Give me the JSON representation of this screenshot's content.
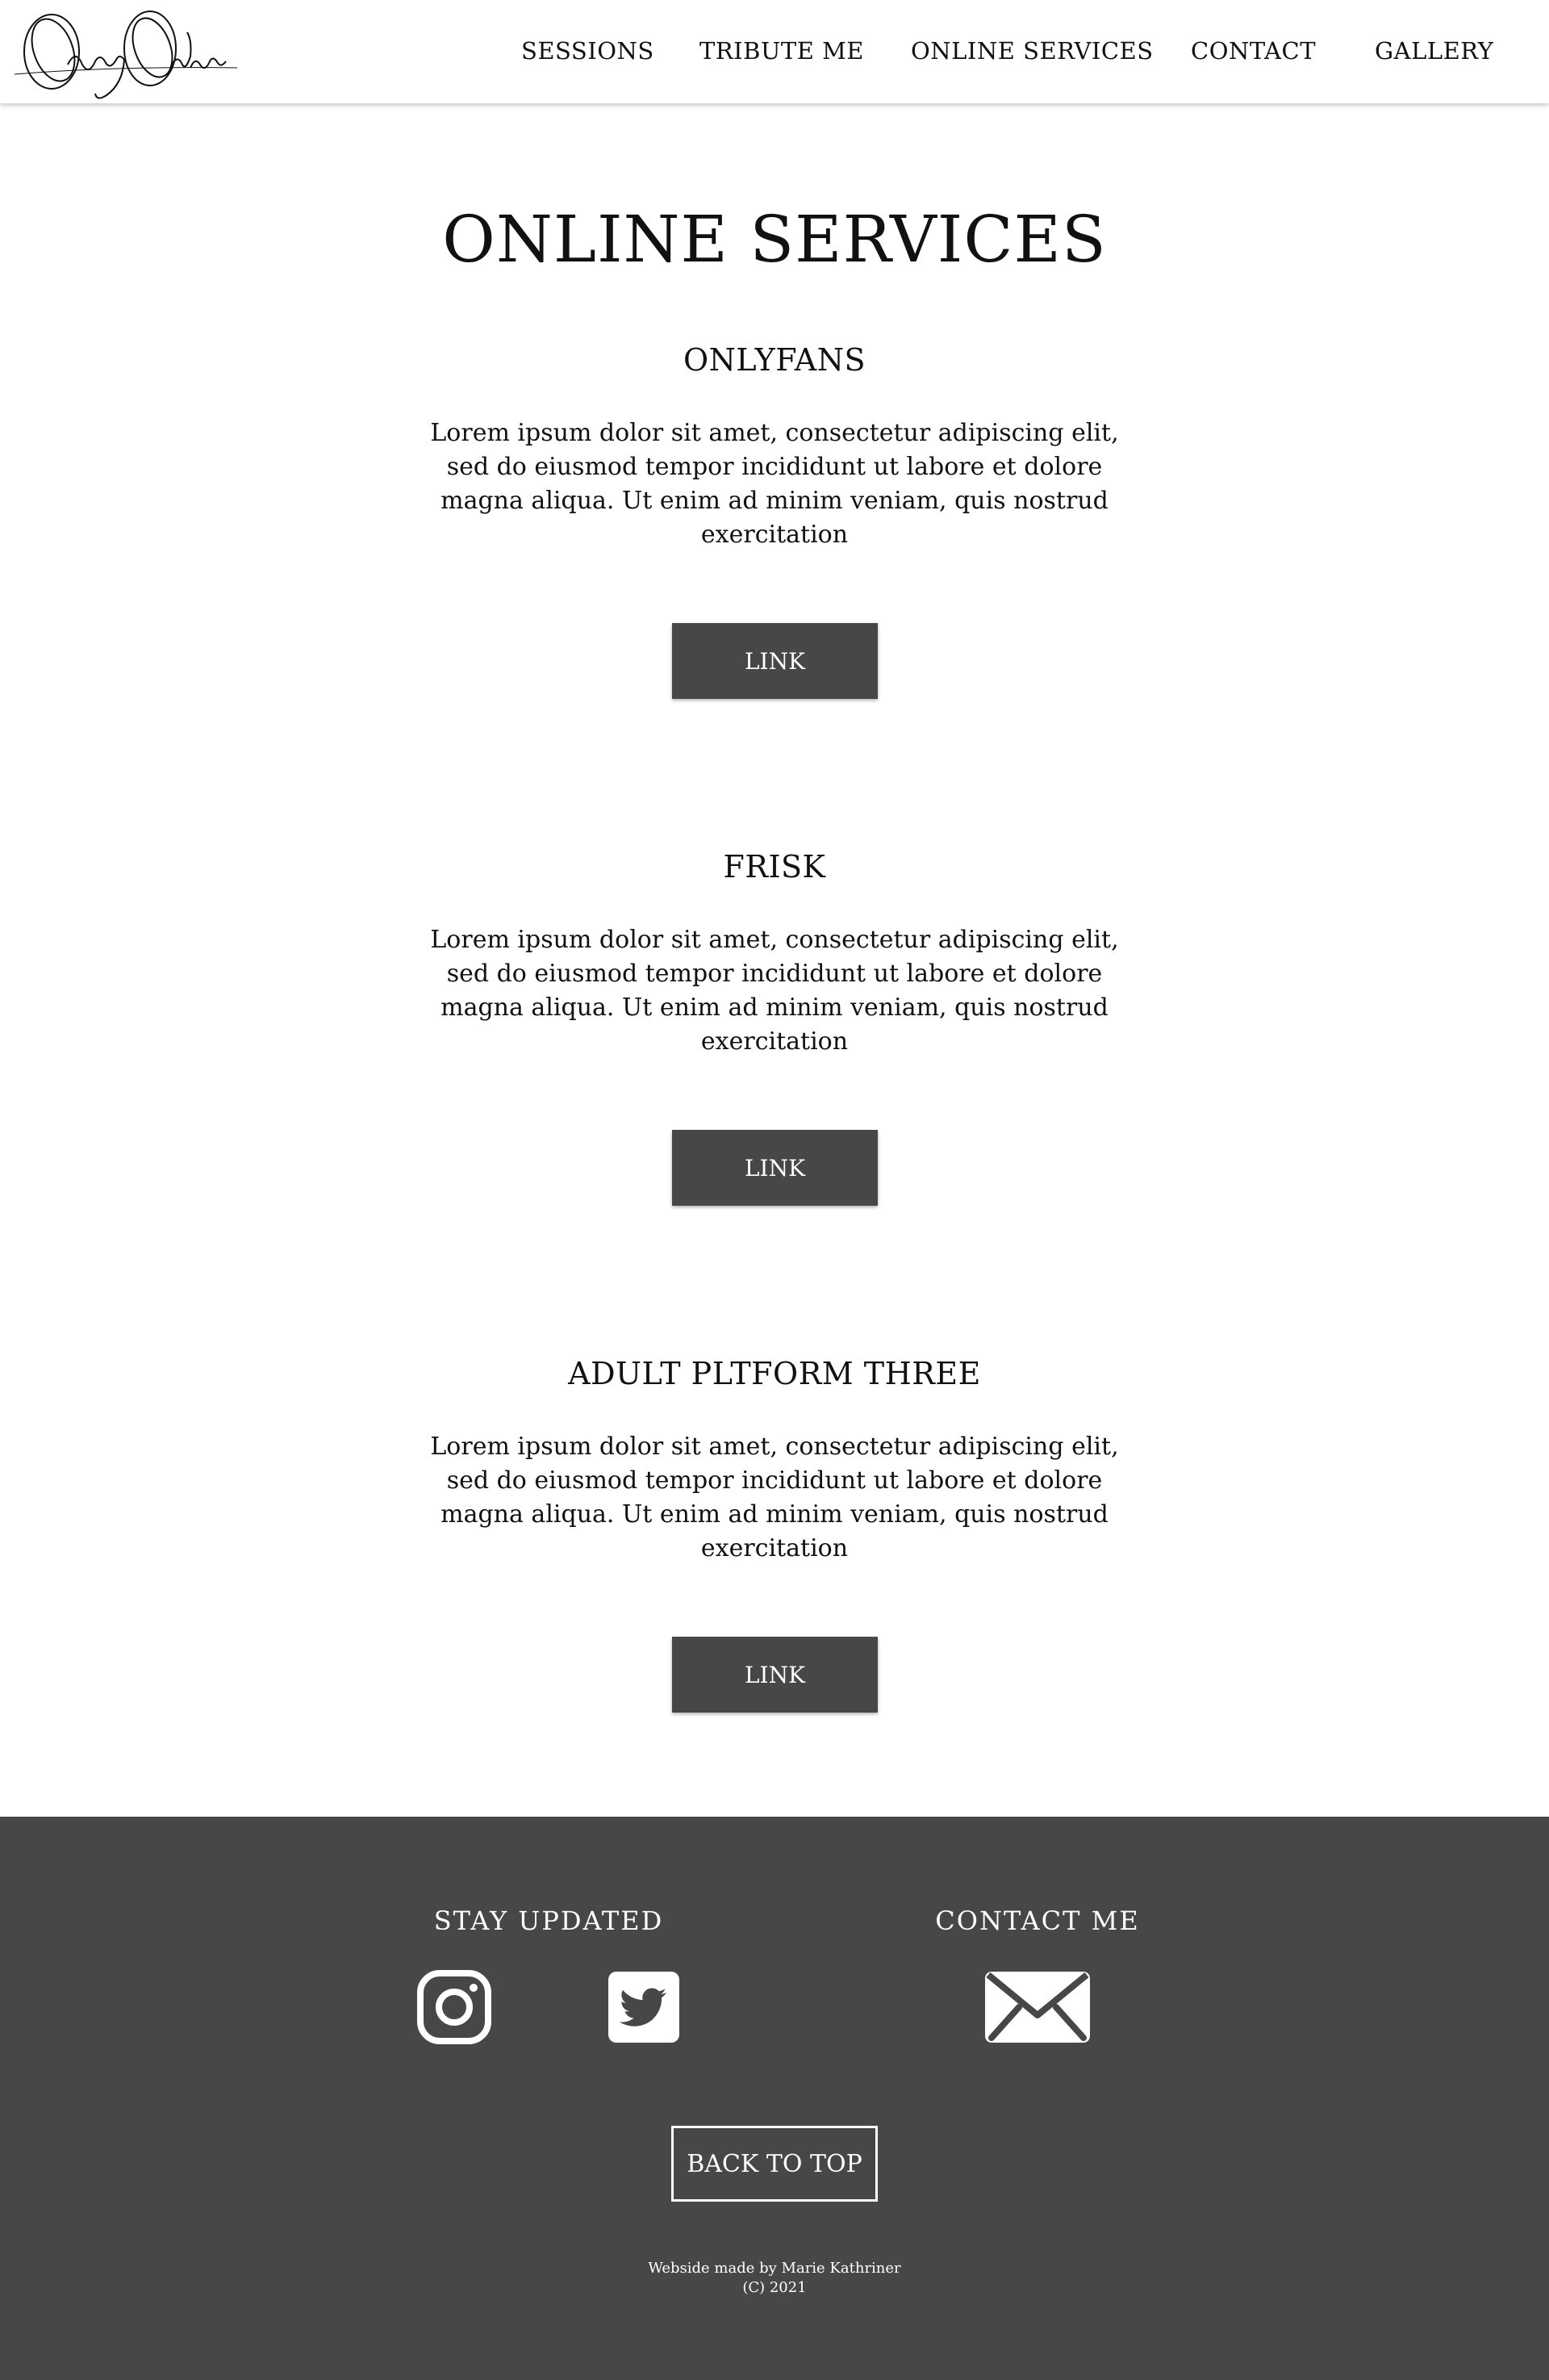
{
  "header": {
    "logo_text": "ObeyOrla",
    "nav": [
      "SESSIONS",
      "TRIBUTE ME",
      "ONLINE SERVICES",
      "CONTACT",
      "GALLERY"
    ]
  },
  "main": {
    "title": "ONLINE SERVICES",
    "services": [
      {
        "name": "ONLYFANS",
        "description": "Lorem ipsum dolor sit amet, consectetur adipiscing elit, sed do eiusmod tempor incididunt ut labore et dolore magna aliqua. Ut enim ad minim veniam, quis nostrud exercitation",
        "button": "LINK"
      },
      {
        "name": "FRISK",
        "description": "Lorem ipsum dolor sit amet, consectetur adipiscing elit, sed do eiusmod tempor incididunt ut labore et dolore magna aliqua. Ut enim ad minim veniam, quis nostrud exercitation",
        "button": "LINK"
      },
      {
        "name": "ADULT PLTFORM THREE",
        "description": "Lorem ipsum dolor sit amet, consectetur adipiscing elit, sed do eiusmod tempor incididunt ut labore et dolore magna aliqua. Ut enim ad minim veniam, quis nostrud exercitation",
        "button": "LINK"
      }
    ]
  },
  "footer": {
    "stay_updated": "STAY UPDATED",
    "contact_me": "CONTACT ME",
    "icons": [
      "instagram-icon",
      "twitter-icon",
      "email-icon"
    ],
    "back_to_top": "BACK TO TOP",
    "credit_line1": "Webside made by Marie Kathriner",
    "credit_line2": "(C) 2021",
    "background_color": "#474747"
  }
}
